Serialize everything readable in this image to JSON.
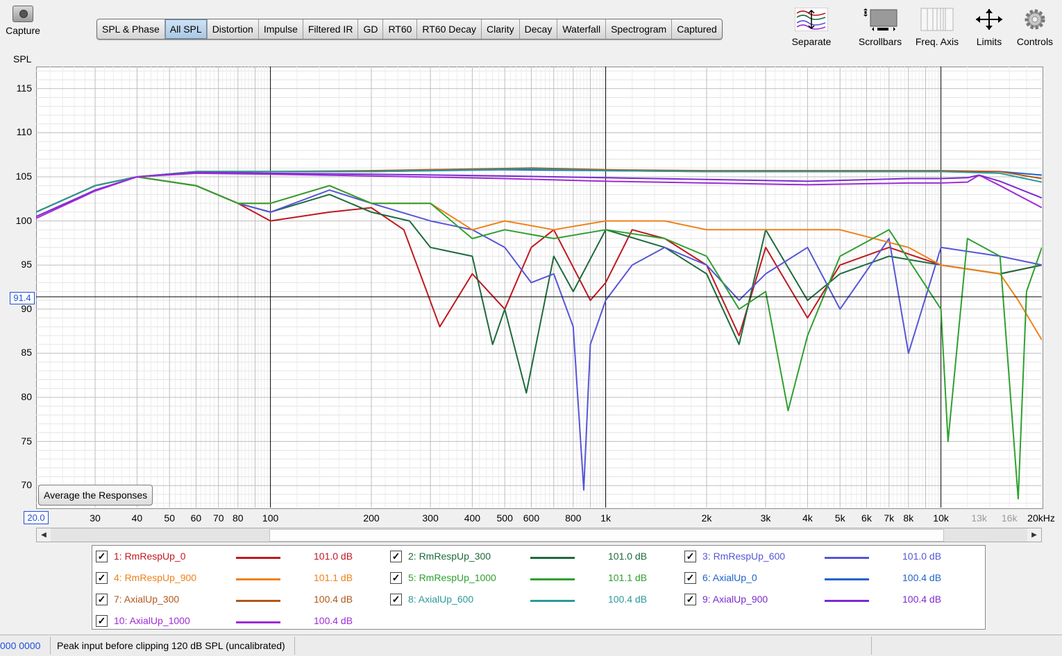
{
  "capture": {
    "label": "Capture",
    "icon": "camera-icon"
  },
  "tabs": [
    "SPL & Phase",
    "All SPL",
    "Distortion",
    "Impulse",
    "Filtered IR",
    "GD",
    "RT60",
    "RT60 Decay",
    "Clarity",
    "Decay",
    "Waterfall",
    "Spectrogram",
    "Captured"
  ],
  "active_tab": "All SPL",
  "toolbar": {
    "separate": "Separate",
    "scrollbars": "Scrollbars",
    "freq_axis": "Freq. Axis",
    "limits": "Limits",
    "controls": "Controls"
  },
  "plot": {
    "y_axis_label": "SPL",
    "y_ticks": [
      "115",
      "110",
      "105",
      "100",
      "95",
      "90",
      "85",
      "80",
      "75",
      "70"
    ],
    "x_ticks": [
      "30",
      "40",
      "50",
      "60",
      "70",
      "80",
      "100",
      "200",
      "300",
      "400",
      "500",
      "600",
      "800",
      "1k",
      "2k",
      "3k",
      "4k",
      "5k",
      "6k",
      "7k",
      "8k",
      "10k",
      "13k",
      "16k",
      "20kHz"
    ],
    "x_ticks_grey": [
      "13k",
      "16k"
    ],
    "cursor_y": "91.4",
    "cursor_x": "20.0",
    "average_button": "Average the Responses"
  },
  "chart_data": {
    "type": "line",
    "xlabel": "",
    "ylabel": "SPL",
    "xscale": "log",
    "xlim": [
      20,
      20000
    ],
    "ylim": [
      67.5,
      117.5
    ],
    "grid": true,
    "series": [
      {
        "name": "1: RmRespUp_0",
        "color": "#c0181f",
        "points": [
          [
            20,
            101
          ],
          [
            30,
            104
          ],
          [
            40,
            105
          ],
          [
            60,
            104
          ],
          [
            80,
            102
          ],
          [
            100,
            100
          ],
          [
            150,
            101
          ],
          [
            200,
            101.5
          ],
          [
            250,
            99
          ],
          [
            320,
            88
          ],
          [
            400,
            94
          ],
          [
            500,
            90
          ],
          [
            600,
            97
          ],
          [
            700,
            99
          ],
          [
            900,
            91
          ],
          [
            1000,
            93
          ],
          [
            1200,
            99
          ],
          [
            1500,
            98
          ],
          [
            2000,
            95
          ],
          [
            2500,
            87
          ],
          [
            3000,
            97
          ],
          [
            4000,
            89
          ],
          [
            5000,
            95
          ],
          [
            7000,
            97
          ],
          [
            10000,
            95
          ],
          [
            15000,
            94
          ],
          [
            20000,
            95
          ]
        ]
      },
      {
        "name": "2: RmRespUp_300",
        "color": "#1c6b3c",
        "points": [
          [
            20,
            101
          ],
          [
            30,
            104
          ],
          [
            40,
            105
          ],
          [
            60,
            104
          ],
          [
            80,
            102
          ],
          [
            100,
            101
          ],
          [
            150,
            103
          ],
          [
            200,
            101
          ],
          [
            260,
            100
          ],
          [
            300,
            97
          ],
          [
            400,
            96
          ],
          [
            460,
            86
          ],
          [
            500,
            90
          ],
          [
            580,
            80.5
          ],
          [
            700,
            96
          ],
          [
            800,
            92
          ],
          [
            1000,
            99
          ],
          [
            1500,
            97
          ],
          [
            2000,
            94
          ],
          [
            2500,
            86
          ],
          [
            3000,
            99
          ],
          [
            4000,
            91
          ],
          [
            5000,
            94
          ],
          [
            7000,
            96
          ],
          [
            10000,
            95
          ],
          [
            15000,
            94
          ],
          [
            20000,
            95
          ]
        ]
      },
      {
        "name": "3: RmRespUp_600",
        "color": "#5555d8",
        "points": [
          [
            20,
            101
          ],
          [
            30,
            104
          ],
          [
            40,
            105
          ],
          [
            60,
            104
          ],
          [
            80,
            102
          ],
          [
            100,
            101
          ],
          [
            150,
            103.5
          ],
          [
            200,
            102
          ],
          [
            300,
            100
          ],
          [
            400,
            99
          ],
          [
            500,
            97
          ],
          [
            600,
            93
          ],
          [
            700,
            94
          ],
          [
            800,
            88
          ],
          [
            860,
            69.5
          ],
          [
            900,
            86
          ],
          [
            1000,
            91
          ],
          [
            1200,
            95
          ],
          [
            1500,
            97
          ],
          [
            2000,
            95
          ],
          [
            2500,
            91
          ],
          [
            3000,
            94
          ],
          [
            4000,
            97
          ],
          [
            5000,
            90
          ],
          [
            7000,
            98
          ],
          [
            8000,
            85
          ],
          [
            10000,
            97
          ],
          [
            15000,
            96
          ],
          [
            20000,
            95
          ]
        ]
      },
      {
        "name": "4: RmRespUp_900",
        "color": "#f08018",
        "points": [
          [
            20,
            101
          ],
          [
            30,
            104
          ],
          [
            40,
            105
          ],
          [
            60,
            104
          ],
          [
            80,
            102
          ],
          [
            100,
            102
          ],
          [
            150,
            104
          ],
          [
            200,
            102
          ],
          [
            300,
            102
          ],
          [
            400,
            99
          ],
          [
            500,
            100
          ],
          [
            700,
            99
          ],
          [
            1000,
            100
          ],
          [
            1500,
            100
          ],
          [
            2000,
            99
          ],
          [
            3000,
            99
          ],
          [
            5000,
            99
          ],
          [
            8000,
            97
          ],
          [
            10000,
            95
          ],
          [
            15000,
            94
          ],
          [
            17000,
            91
          ],
          [
            20000,
            86.5
          ]
        ]
      },
      {
        "name": "5: RmRespUp_1000",
        "color": "#2ea02e",
        "points": [
          [
            20,
            101
          ],
          [
            30,
            104
          ],
          [
            40,
            105
          ],
          [
            60,
            104
          ],
          [
            80,
            102
          ],
          [
            100,
            102
          ],
          [
            150,
            104
          ],
          [
            200,
            102
          ],
          [
            300,
            102
          ],
          [
            400,
            98
          ],
          [
            500,
            99
          ],
          [
            700,
            98
          ],
          [
            1000,
            99
          ],
          [
            1500,
            98
          ],
          [
            2000,
            96
          ],
          [
            2500,
            90
          ],
          [
            3000,
            92
          ],
          [
            3500,
            78.5
          ],
          [
            4000,
            87
          ],
          [
            5000,
            96
          ],
          [
            7000,
            99
          ],
          [
            10000,
            90
          ],
          [
            10500,
            75
          ],
          [
            12000,
            98
          ],
          [
            15000,
            96
          ],
          [
            17000,
            68.5
          ],
          [
            18000,
            92
          ],
          [
            20000,
            97
          ]
        ]
      },
      {
        "name": "6: AxialUp_0",
        "color": "#1e63c9",
        "points": [
          [
            20,
            101
          ],
          [
            30,
            104
          ],
          [
            40,
            105
          ],
          [
            60,
            105.6
          ],
          [
            100,
            105.6
          ],
          [
            200,
            105.6
          ],
          [
            500,
            105.8
          ],
          [
            1000,
            105.7
          ],
          [
            2000,
            105.6
          ],
          [
            5000,
            105.6
          ],
          [
            10000,
            105.6
          ],
          [
            15000,
            105.6
          ],
          [
            20000,
            105.2
          ]
        ]
      },
      {
        "name": "7: AxialUp_300",
        "color": "#b0581b",
        "points": [
          [
            20,
            101
          ],
          [
            30,
            104
          ],
          [
            40,
            105
          ],
          [
            60,
            105.6
          ],
          [
            100,
            105.6
          ],
          [
            200,
            105.7
          ],
          [
            600,
            106
          ],
          [
            1000,
            105.8
          ],
          [
            2000,
            105.7
          ],
          [
            5000,
            105.7
          ],
          [
            10000,
            105.7
          ],
          [
            15000,
            105.6
          ],
          [
            20000,
            104.8
          ]
        ]
      },
      {
        "name": "8: AxialUp_600",
        "color": "#2a9a9a",
        "points": [
          [
            20,
            101
          ],
          [
            30,
            104
          ],
          [
            40,
            105
          ],
          [
            60,
            105.6
          ],
          [
            100,
            105.6
          ],
          [
            200,
            105.6
          ],
          [
            600,
            105.9
          ],
          [
            1000,
            105.7
          ],
          [
            2000,
            105.6
          ],
          [
            5000,
            105.6
          ],
          [
            10000,
            105.6
          ],
          [
            15000,
            105.4
          ],
          [
            20000,
            104.4
          ]
        ]
      },
      {
        "name": "9: AxialUp_900",
        "color": "#7b2ad0",
        "points": [
          [
            20,
            100.5
          ],
          [
            30,
            103.5
          ],
          [
            40,
            105
          ],
          [
            60,
            105.5
          ],
          [
            100,
            105.4
          ],
          [
            200,
            105.3
          ],
          [
            500,
            105.1
          ],
          [
            1000,
            104.9
          ],
          [
            2000,
            104.7
          ],
          [
            4000,
            104.5
          ],
          [
            8000,
            104.8
          ],
          [
            10000,
            104.8
          ],
          [
            12000,
            104.9
          ],
          [
            13000,
            105.2
          ],
          [
            15000,
            104.5
          ],
          [
            20000,
            102.6
          ]
        ]
      },
      {
        "name": "10: AxialUp_1000",
        "color": "#a02ad8",
        "points": [
          [
            20,
            100.3
          ],
          [
            30,
            103.4
          ],
          [
            40,
            105
          ],
          [
            60,
            105.4
          ],
          [
            100,
            105.3
          ],
          [
            200,
            105.1
          ],
          [
            500,
            104.8
          ],
          [
            1000,
            104.5
          ],
          [
            2000,
            104.3
          ],
          [
            4000,
            104.1
          ],
          [
            8000,
            104.3
          ],
          [
            10000,
            104.3
          ],
          [
            12000,
            104.4
          ],
          [
            13000,
            105.2
          ],
          [
            15000,
            104
          ],
          [
            20000,
            101.5
          ]
        ]
      }
    ]
  },
  "legend": [
    {
      "label": "1: RmRespUp_0",
      "value": "101.0 dB",
      "color": "#c0181f",
      "checked": "✓"
    },
    {
      "label": "2: RmRespUp_300",
      "value": "101.0 dB",
      "color": "#1c6b3c",
      "checked": "✓"
    },
    {
      "label": "3: RmRespUp_600",
      "value": "101.0 dB",
      "color": "#5555d8",
      "checked": "✓"
    },
    {
      "label": "4: RmRespUp_900",
      "value": "101.1 dB",
      "color": "#f08018",
      "checked": "✓"
    },
    {
      "label": "5: RmRespUp_1000",
      "value": "101.1 dB",
      "color": "#2ea02e",
      "checked": "✓"
    },
    {
      "label": "6: AxialUp_0",
      "value": "100.4 dB",
      "color": "#1e63c9",
      "checked": "✓"
    },
    {
      "label": "7: AxialUp_300",
      "value": "100.4 dB",
      "color": "#b0581b",
      "checked": "✓"
    },
    {
      "label": "8: AxialUp_600",
      "value": "100.4 dB",
      "color": "#2a9a9a",
      "checked": "✓"
    },
    {
      "label": "9: AxialUp_900",
      "value": "100.4 dB",
      "color": "#7b2ad0",
      "checked": "✓"
    },
    {
      "label": "10: AxialUp_1000",
      "value": "100.4 dB",
      "color": "#a02ad8",
      "checked": "✓"
    }
  ],
  "status": {
    "counter": "000 0000",
    "message": "Peak input before clipping 120 dB SPL (uncalibrated)"
  }
}
